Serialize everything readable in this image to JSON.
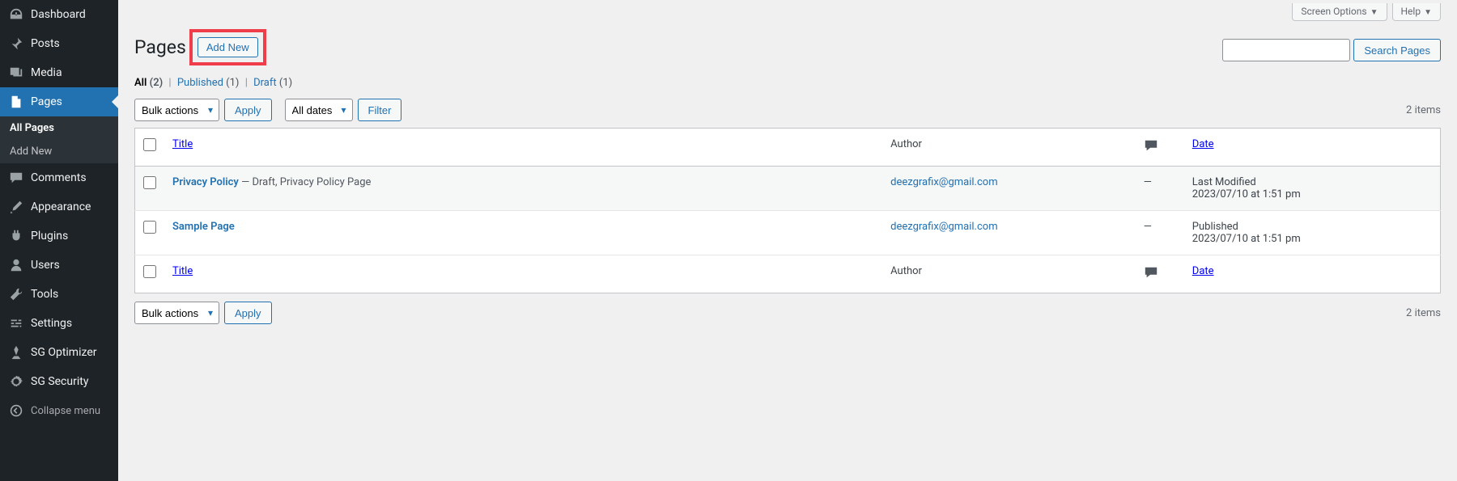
{
  "topbar": {
    "screen_options": "Screen Options",
    "help": "Help"
  },
  "sidebar": {
    "items": [
      {
        "label": "Dashboard"
      },
      {
        "label": "Posts"
      },
      {
        "label": "Media"
      },
      {
        "label": "Pages"
      },
      {
        "label": "Comments"
      },
      {
        "label": "Appearance"
      },
      {
        "label": "Plugins"
      },
      {
        "label": "Users"
      },
      {
        "label": "Tools"
      },
      {
        "label": "Settings"
      },
      {
        "label": "SG Optimizer"
      },
      {
        "label": "SG Security"
      }
    ],
    "submenu": [
      {
        "label": "All Pages"
      },
      {
        "label": "Add New"
      }
    ],
    "collapse": "Collapse menu"
  },
  "heading": {
    "title": "Pages",
    "add_new": "Add New"
  },
  "subsub": {
    "all": "All",
    "all_count": "(2)",
    "published": "Published",
    "published_count": "(1)",
    "draft": "Draft",
    "draft_count": "(1)"
  },
  "actions": {
    "bulk": "Bulk actions",
    "apply": "Apply",
    "all_dates": "All dates",
    "filter": "Filter",
    "search": "Search Pages",
    "items_count": "2 items"
  },
  "table": {
    "head": {
      "title": "Title",
      "author": "Author",
      "date": "Date"
    },
    "rows": [
      {
        "title": "Privacy Policy",
        "state": " — Draft, Privacy Policy Page",
        "author": "deezgrafix@gmail.com",
        "comments": "—",
        "date_label": "Last Modified",
        "date_value": "2023/07/10 at 1:51 pm"
      },
      {
        "title": "Sample Page",
        "state": "",
        "author": "deezgrafix@gmail.com",
        "comments": "—",
        "date_label": "Published",
        "date_value": "2023/07/10 at 1:51 pm"
      }
    ]
  }
}
